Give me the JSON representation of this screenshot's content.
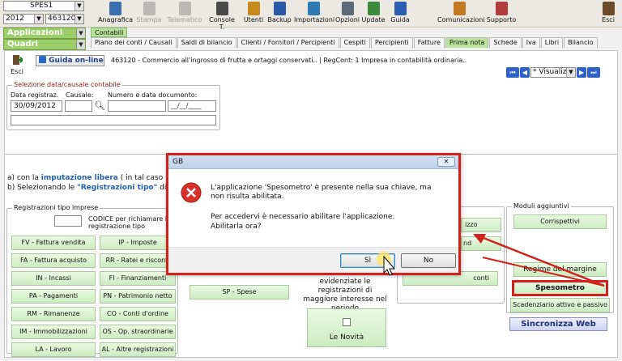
{
  "topbar": {
    "company_code": "SPES1",
    "year": "2012",
    "company_number": "463120 -",
    "toolbar": [
      {
        "label": "Anagrafica",
        "icon": "registry-icon",
        "enabled": true
      },
      {
        "label": "Stampa",
        "icon": "printer-icon",
        "enabled": false
      },
      {
        "label": "Telematico",
        "icon": "telematic-icon",
        "enabled": false
      },
      {
        "label": "Console T.",
        "icon": "console-icon",
        "enabled": true
      },
      {
        "label": "Utenti",
        "icon": "users-icon",
        "enabled": true
      },
      {
        "label": "Backup",
        "icon": "backup-icon",
        "enabled": true
      },
      {
        "label": "Importazioni",
        "icon": "import-icon",
        "enabled": true
      },
      {
        "label": "Opzioni",
        "icon": "options-icon",
        "enabled": true
      },
      {
        "label": "Update",
        "icon": "update-icon",
        "enabled": true
      },
      {
        "label": "Guida",
        "icon": "guide-icon",
        "enabled": true
      },
      {
        "label": "Comunicazioni",
        "icon": "communications-icon",
        "enabled": true
      },
      {
        "label": "Supporto",
        "icon": "support-icon",
        "enabled": true
      },
      {
        "label": "Esci",
        "icon": "exit-icon",
        "enabled": true
      }
    ]
  },
  "nav": {
    "applicazioni": "Applicazioni",
    "quadri": "Quadri",
    "contabili": "Contabili",
    "tabs": [
      {
        "label": "Piano dei conti / Causali",
        "active": false
      },
      {
        "label": "Saldi di bilancio",
        "active": false
      },
      {
        "label": "Clienti / Fornitori / Percipienti",
        "active": false
      },
      {
        "label": "Cespiti",
        "active": false
      },
      {
        "label": "Percipienti",
        "active": false
      },
      {
        "label": "Fatture",
        "active": false
      },
      {
        "label": "Prima nota",
        "active": true
      },
      {
        "label": "Schede",
        "active": false
      },
      {
        "label": "Iva",
        "active": false
      },
      {
        "label": "Libri",
        "active": false
      },
      {
        "label": "Bilancio",
        "active": false
      }
    ]
  },
  "panel": {
    "esci": "Esci",
    "guida": "Guida on-line",
    "company_info": "463120 - Commercio all'ingrosso di frutta e ortaggi conservati..  | RegCont: 1 Impresa  in contabilità ordinaria..",
    "view_mode": "* Visualiz",
    "selection": {
      "legend": "Selezione data/causale contabile",
      "date_label": "Data registraz.",
      "date_value": "30/09/2012",
      "causale_label": "Causale:",
      "numero_label": "Numero e data documento:",
      "doc_date_placeholder": "__/__/____"
    },
    "info_line_a_prefix": "a) con la ",
    "info_line_a_link": "imputazione libera",
    "info_line_a_suffix": " ( in tal caso l'ut",
    "info_line_b_prefix": "b) Selezionando le ",
    "info_line_b_link": "\"Registrazioni tipo\"",
    "info_line_b_suffix": " dispon",
    "registrazioni": {
      "legend": "Registrazioni tipo imprese",
      "codice_note": "CODICE per richiamare la registrazione tipo",
      "left": [
        "FV - Fattura vendita",
        "FA - Fattura acquisto",
        "IN - Incassi",
        "PA - Pagamenti",
        "RM - Rimanenze",
        "IM - Immobilizzazioni",
        "LA - Lavoro"
      ],
      "right": [
        "IP - Imposte",
        "RR - Ratei e risconti",
        "FI - Finanziamenti",
        "PN - Patrimonio netto",
        "CO - Conti d'ordine",
        "OS - Op. straordinarie",
        "AL - Altre registrazioni"
      ]
    },
    "spese": "SP - Spese",
    "news_text": "evidenziate le registrazioni di maggiore interesse nel periodo",
    "novita": "Le Novità",
    "mid_btn_1": "izzo",
    "mid_btn_2": "nd",
    "mid_btn_3": "conti",
    "moduli": {
      "legend": "Moduli aggiuntivi",
      "corrispettivi": "Corrispettivi",
      "regime": "Regime del margine",
      "spesometro": "Spesometro",
      "scadenziario": "Scadenziario attivo e passivo",
      "sincronizza": "Sincronizza Web"
    }
  },
  "dialog": {
    "title": "GB",
    "close": "✕",
    "message_1": "L'applicazione 'Spesometro' è presente nella sua chiave, ma non risulta abilitata.",
    "message_2": "Per accedervi è necessario abilitare l'applicazione.",
    "message_3": "Abilitarla ora?",
    "yes": "Sì",
    "no": "No"
  },
  "colors": {
    "highlight_red": "#d2201b",
    "module_green": "#b7e39a",
    "link_blue": "#1f5fae"
  }
}
